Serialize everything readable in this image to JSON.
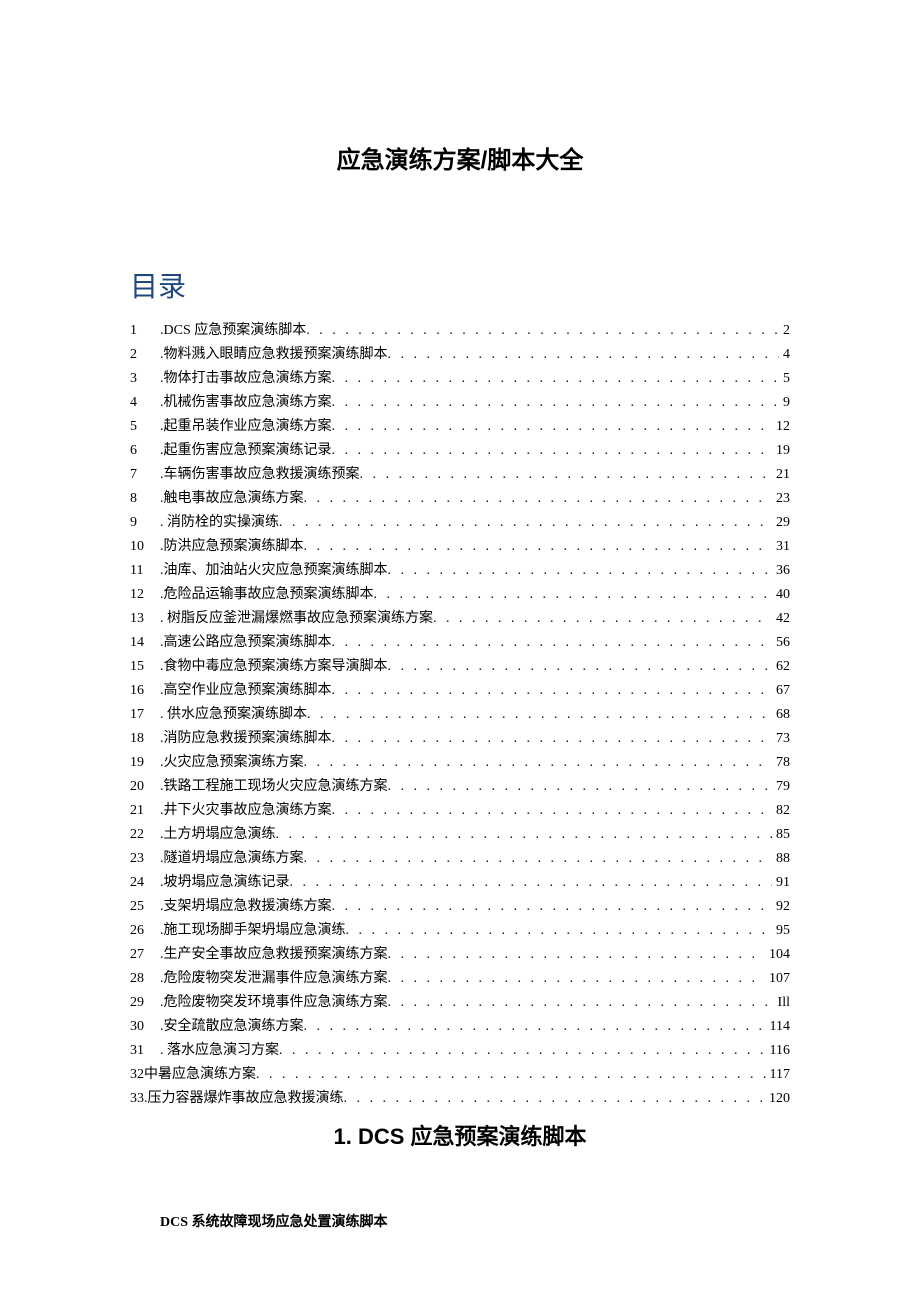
{
  "title": "应急演练方案/脚本大全",
  "toc_heading": "目录",
  "toc": [
    {
      "num": "1",
      "label": "DCS 应急预案演练脚本",
      "page": "2",
      "prefix": true,
      "inline": false
    },
    {
      "num": "2",
      "label": "物料溅入眼睛应急救援预案演练脚本",
      "page": "4",
      "prefix": true,
      "inline": false
    },
    {
      "num": "3",
      "label": "物体打击事故应急演练方案",
      "page": "5",
      "prefix": true,
      "inline": false
    },
    {
      "num": "4",
      "label": "机械伤害事故应急演练方案",
      "page": "9",
      "prefix": true,
      "inline": false
    },
    {
      "num": "5",
      "label": "起重吊装作业应急演练方案",
      "page": "12",
      "prefix": true,
      "inline": false
    },
    {
      "num": "6",
      "label": "起重伤害应急预案演练记录",
      "page": "19",
      "prefix": true,
      "inline": false
    },
    {
      "num": "7",
      "label": "车辆伤害事故应急救援演练预案",
      "page": "21",
      "prefix": true,
      "inline": false
    },
    {
      "num": "8",
      "label": "触电事故应急演练方案",
      "page": "23",
      "prefix": true,
      "inline": false
    },
    {
      "num": "9",
      "label": " 消防栓的实操演练 ",
      "page": "29",
      "prefix": true,
      "inline": false
    },
    {
      "num": "10",
      "label": "防洪应急预案演练脚本",
      "page": "31",
      "prefix": true,
      "inline": false
    },
    {
      "num": "11",
      "label": "油库、加油站火灾应急预案演练脚本",
      "page": "36",
      "prefix": true,
      "inline": false
    },
    {
      "num": "12",
      "label": "危险品运输事故应急预案演练脚本",
      "page": "40",
      "prefix": true,
      "inline": false
    },
    {
      "num": "13",
      "label": " 树脂反应釜泄漏爆燃事故应急预案演练方案 ",
      "page": "42",
      "prefix": true,
      "inline": false
    },
    {
      "num": "14",
      "label": "高速公路应急预案演练脚本",
      "page": "56",
      "prefix": true,
      "inline": false
    },
    {
      "num": "15",
      "label": "食物中毒应急预案演练方案导演脚本",
      "page": "62",
      "prefix": true,
      "inline": false
    },
    {
      "num": "16",
      "label": "高空作业应急预案演练脚本",
      "page": "67",
      "prefix": true,
      "inline": false
    },
    {
      "num": "17",
      "label": " 供水应急预案演练脚本 ",
      "page": "68",
      "prefix": true,
      "inline": false
    },
    {
      "num": "18",
      "label": "消防应急救援预案演练脚本",
      "page": "73",
      "prefix": true,
      "inline": false
    },
    {
      "num": "19",
      "label": "火灾应急预案演练方案",
      "page": "78",
      "prefix": true,
      "inline": false
    },
    {
      "num": "20",
      "label": "铁路工程施工现场火灾应急演练方案",
      "page": "79",
      "prefix": true,
      "inline": false
    },
    {
      "num": "21",
      "label": "井下火灾事故应急演练方案",
      "page": "82",
      "prefix": true,
      "inline": false
    },
    {
      "num": "22",
      "label": "土方坍塌应急演练",
      "page": "85",
      "prefix": true,
      "inline": false
    },
    {
      "num": "23",
      "label": "隧道坍塌应急演练方案",
      "page": "88",
      "prefix": true,
      "inline": false
    },
    {
      "num": "24",
      "label": "坡坍塌应急演练记录",
      "page": "91",
      "prefix": true,
      "inline": false
    },
    {
      "num": "25",
      "label": "支架坍塌应急救援演练方案",
      "page": "92",
      "prefix": true,
      "inline": false
    },
    {
      "num": "26",
      "label": "施工现场脚手架坍塌应急演练",
      "page": "95",
      "prefix": true,
      "inline": false
    },
    {
      "num": "27",
      "label": "生产安全事故应急救援预案演练方案",
      "page": "104",
      "prefix": true,
      "inline": false
    },
    {
      "num": "28",
      "label": "危险废物突发泄漏事件应急演练方案",
      "page": "107",
      "prefix": true,
      "inline": false
    },
    {
      "num": "29",
      "label": "危险废物突发环境事件应急演练方案",
      "page": "Ill",
      "prefix": true,
      "inline": false
    },
    {
      "num": "30",
      "label": "安全疏散应急演练方案",
      "page": "114",
      "prefix": true,
      "inline": false
    },
    {
      "num": "31",
      "label": " 落水应急演习方案",
      "page": "116",
      "prefix": true,
      "inline": false
    },
    {
      "num": "32",
      "label": "中暑应急演练方案",
      "page": "117",
      "prefix": false,
      "inline": true
    },
    {
      "num": "33.",
      "label": "压力容器爆炸事故应急救援演练",
      "page": "120",
      "prefix": false,
      "inline": true
    }
  ],
  "section_heading": "1.  DCS 应急预案演练脚本",
  "body_line": "DCS 系统故障现场应急处置演练脚本"
}
